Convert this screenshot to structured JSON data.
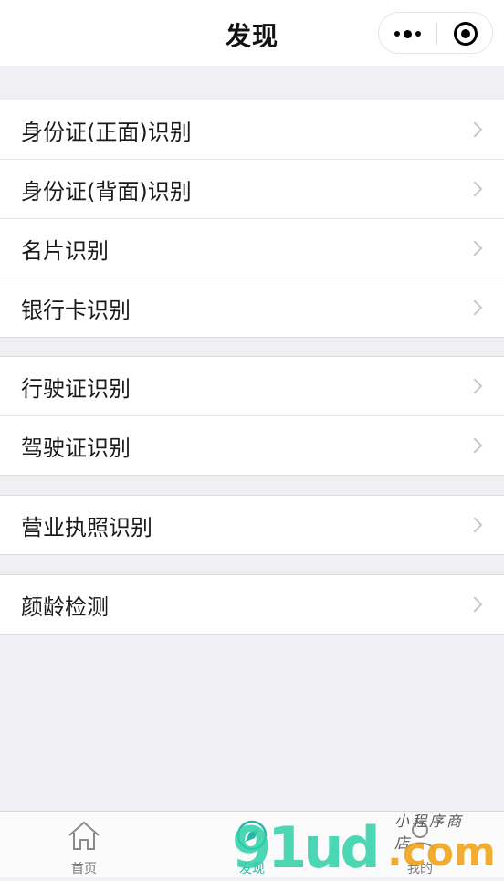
{
  "header": {
    "title": "发现"
  },
  "groups": [
    {
      "items": [
        {
          "label": "身份证(正面)识别"
        },
        {
          "label": "身份证(背面)识别"
        },
        {
          "label": "名片识别"
        },
        {
          "label": "银行卡识别"
        }
      ]
    },
    {
      "items": [
        {
          "label": "行驶证识别"
        },
        {
          "label": "驾驶证识别"
        }
      ]
    },
    {
      "items": [
        {
          "label": "营业执照识别"
        }
      ]
    },
    {
      "items": [
        {
          "label": "颜龄检测"
        }
      ]
    }
  ],
  "tabbar": {
    "tabs": [
      {
        "label": "首页",
        "icon": "home-icon"
      },
      {
        "label": "发现",
        "icon": "discover-icon",
        "active": true
      },
      {
        "label": "我的",
        "icon": "profile-icon"
      }
    ]
  },
  "watermark": {
    "brand": "91ud",
    "suffix": ".com",
    "tagline": "小程序商店"
  },
  "colors": {
    "accent": "#2bb3a8",
    "background": "#efeff4"
  },
  "icons": [
    "more-dots-icon",
    "close-capsule-icon",
    "chevron-right-icon"
  ]
}
